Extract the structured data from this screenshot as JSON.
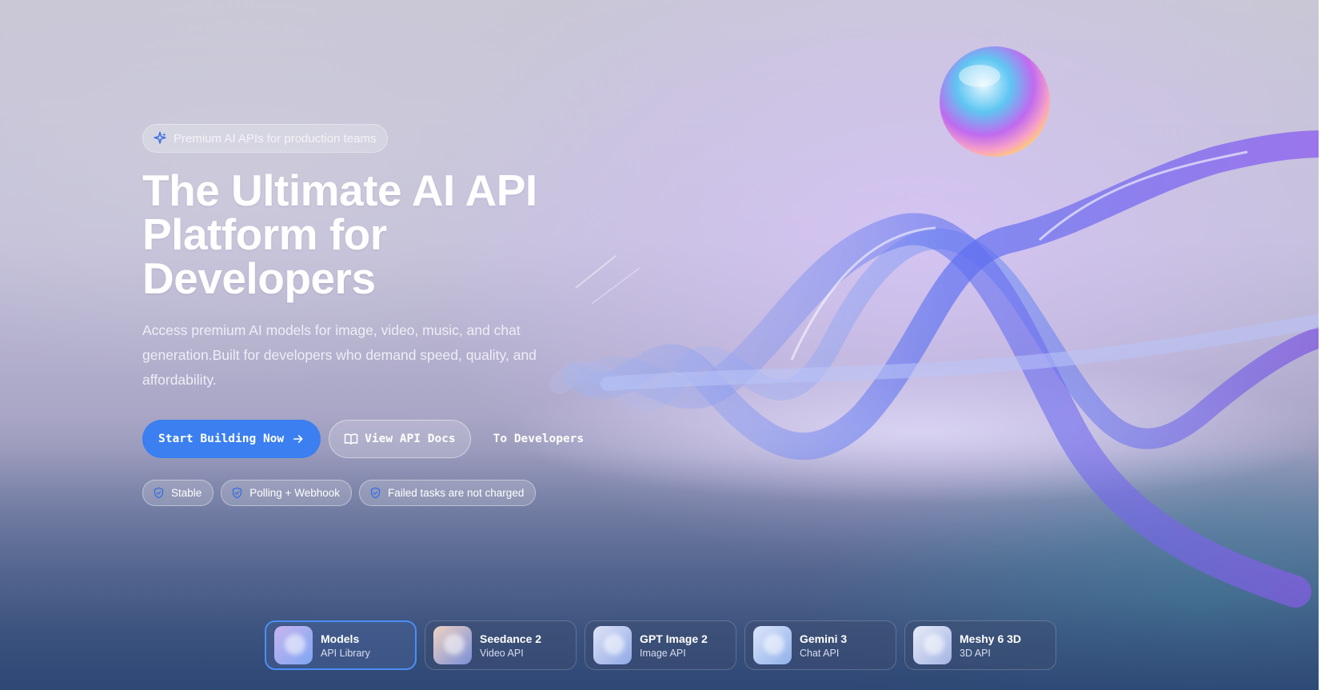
{
  "hero": {
    "badge": "Premium AI APIs for production teams",
    "title_lines": [
      "The Ultimate AI API",
      "Platform for",
      "Developers"
    ],
    "description": "Access premium AI models for image, video, music, and chat generation.Built for developers who demand speed, quality, and affordability."
  },
  "actions": {
    "primary_label": "Start Building Now",
    "docs_label": "View API Docs",
    "developers_label": "To Developers"
  },
  "features": [
    {
      "label": "Stable",
      "icon": "shield-icon"
    },
    {
      "label": "Polling + Webhook",
      "icon": "shield-icon"
    },
    {
      "label": "Failed tasks are not charged",
      "icon": "shield-icon"
    }
  ],
  "cards": [
    {
      "title": "Models",
      "subtitle": "API Library",
      "active": true,
      "colors": [
        "#c8b5f0",
        "#7fa6f2"
      ]
    },
    {
      "title": "Seedance 2",
      "subtitle": "Video API",
      "active": false,
      "colors": [
        "#f0d3c2",
        "#7b8fd8"
      ]
    },
    {
      "title": "GPT Image 2",
      "subtitle": "Image API",
      "active": false,
      "colors": [
        "#dfe4f7",
        "#8fa8e6"
      ]
    },
    {
      "title": "Gemini 3",
      "subtitle": "Chat API",
      "active": false,
      "colors": [
        "#dde6fb",
        "#8fb0ea"
      ]
    },
    {
      "title": "Meshy 6 3D",
      "subtitle": "3D API",
      "active": false,
      "colors": [
        "#e7ecf9",
        "#a3b3e4"
      ]
    }
  ],
  "theme": {
    "accent": "#3b7ff0",
    "icon_blue": "#3a6fe0"
  }
}
